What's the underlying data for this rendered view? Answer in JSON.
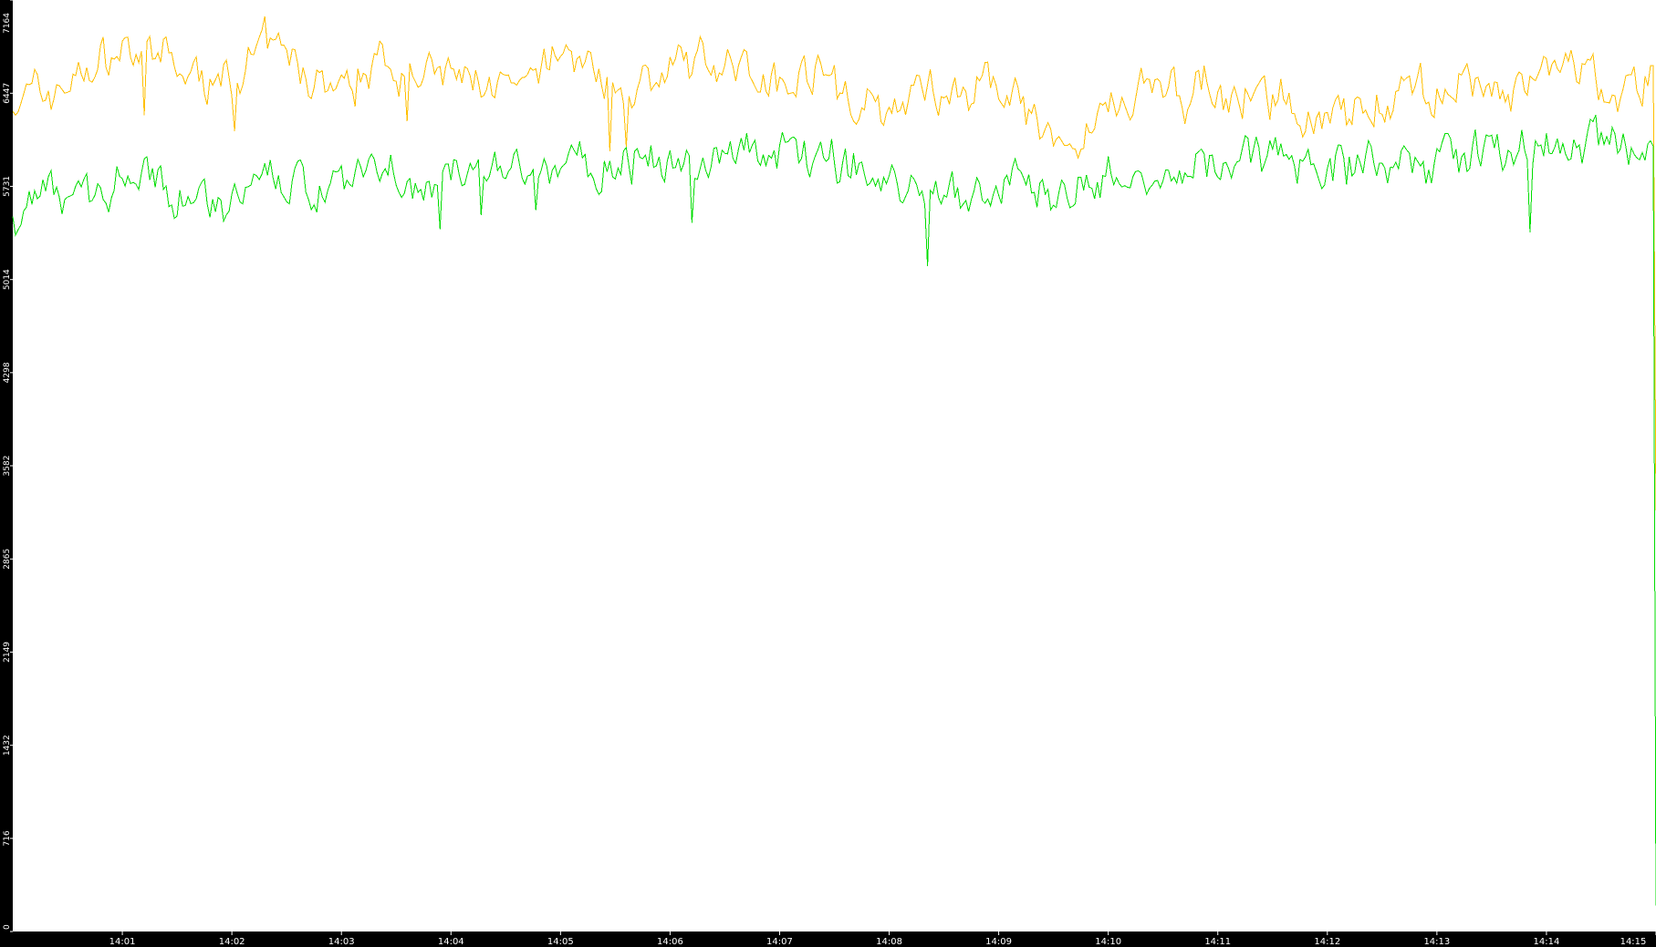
{
  "chart_data": {
    "type": "line",
    "title": "",
    "xlabel": "",
    "ylabel": "",
    "grid": false,
    "legend": "none",
    "background": "#ffffff",
    "axis_color": "#000000",
    "ylim": [
      0,
      7164
    ],
    "y_ticks": [
      {
        "value": 0,
        "label": "0"
      },
      {
        "value": 716,
        "label": "716"
      },
      {
        "value": 1432,
        "label": "1432"
      },
      {
        "value": 2149,
        "label": "2149"
      },
      {
        "value": 2865,
        "label": "2865"
      },
      {
        "value": 3582,
        "label": "3582"
      },
      {
        "value": 4298,
        "label": "4298"
      },
      {
        "value": 5014,
        "label": "5014"
      },
      {
        "value": 5731,
        "label": "5731"
      },
      {
        "value": 6447,
        "label": "6447"
      },
      {
        "value": 7164,
        "label": "7164"
      }
    ],
    "xlim": [
      "14:00",
      "14:15"
    ],
    "x_ticks": [
      {
        "value": "14:01",
        "label": "14:01"
      },
      {
        "value": "14:02",
        "label": "14:02"
      },
      {
        "value": "14:03",
        "label": "14:03"
      },
      {
        "value": "14:04",
        "label": "14:04"
      },
      {
        "value": "14:05",
        "label": "14:05"
      },
      {
        "value": "14:06",
        "label": "14:06"
      },
      {
        "value": "14:07",
        "label": "14:07"
      },
      {
        "value": "14:08",
        "label": "14:08"
      },
      {
        "value": "14:09",
        "label": "14:09"
      },
      {
        "value": "14:10",
        "label": "14:10"
      },
      {
        "value": "14:11",
        "label": "14:11"
      },
      {
        "value": "14:12",
        "label": "14:12"
      },
      {
        "value": "14:13",
        "label": "14:13"
      },
      {
        "value": "14:14",
        "label": "14:14"
      },
      {
        "value": "14:15",
        "label": "14:15"
      }
    ],
    "series": [
      {
        "color": "#ffbf00",
        "x": [
          "14:00:00",
          "14:00:20",
          "14:00:40",
          "14:01:00",
          "14:01:20",
          "14:01:40",
          "14:02:00",
          "14:02:20",
          "14:02:40",
          "14:03:00",
          "14:03:20",
          "14:03:40",
          "14:04:00",
          "14:04:20",
          "14:04:40",
          "14:05:00",
          "14:05:20",
          "14:05:40",
          "14:06:00",
          "14:06:20",
          "14:06:40",
          "14:07:00",
          "14:07:20",
          "14:07:40",
          "14:08:00",
          "14:08:20",
          "14:08:40",
          "14:09:00",
          "14:09:20",
          "14:09:40",
          "14:10:00",
          "14:10:20",
          "14:10:40",
          "14:11:00",
          "14:11:20",
          "14:11:40",
          "14:12:00",
          "14:12:20",
          "14:12:40",
          "14:13:00",
          "14:13:20",
          "14:13:40",
          "14:14:00",
          "14:14:20",
          "14:14:40",
          "14:14:59",
          "14:15:00"
        ],
        "values": [
          6400,
          6450,
          6600,
          6800,
          6700,
          6550,
          6550,
          6800,
          6600,
          6450,
          6750,
          6600,
          6550,
          6550,
          6400,
          6800,
          6600,
          6500,
          6600,
          6700,
          6650,
          6550,
          6650,
          6400,
          6300,
          6500,
          6450,
          6500,
          6200,
          6000,
          6350,
          6500,
          6450,
          6450,
          6350,
          6350,
          6300,
          6350,
          6400,
          6450,
          6500,
          6400,
          6600,
          6550,
          6450,
          6600,
          3240
        ]
      },
      {
        "color": "#00dd00",
        "x": [
          "14:00:00",
          "14:00:20",
          "14:00:40",
          "14:01:00",
          "14:01:20",
          "14:01:40",
          "14:02:00",
          "14:02:20",
          "14:02:40",
          "14:03:00",
          "14:03:20",
          "14:03:40",
          "14:04:00",
          "14:04:20",
          "14:04:40",
          "14:05:00",
          "14:05:20",
          "14:05:40",
          "14:06:00",
          "14:06:20",
          "14:06:40",
          "14:07:00",
          "14:07:20",
          "14:07:40",
          "14:08:00",
          "14:08:20",
          "14:08:40",
          "14:09:00",
          "14:09:20",
          "14:09:40",
          "14:10:00",
          "14:10:20",
          "14:10:40",
          "14:11:00",
          "14:11:20",
          "14:11:40",
          "14:12:00",
          "14:12:20",
          "14:12:40",
          "14:13:00",
          "14:13:20",
          "14:13:40",
          "14:14:00",
          "14:14:20",
          "14:14:40",
          "14:14:59",
          "14:15:00"
        ],
        "values": [
          5500,
          5700,
          5650,
          5850,
          5750,
          5650,
          5650,
          5750,
          5700,
          5800,
          5800,
          5750,
          5800,
          5850,
          5800,
          5850,
          5900,
          5950,
          5950,
          5950,
          6000,
          5950,
          6000,
          5900,
          5700,
          5750,
          5650,
          5750,
          5700,
          5700,
          5800,
          5800,
          5850,
          5950,
          6000,
          6000,
          5900,
          5900,
          5900,
          5950,
          5950,
          5950,
          6000,
          6050,
          6000,
          6100,
          200
        ]
      }
    ]
  }
}
